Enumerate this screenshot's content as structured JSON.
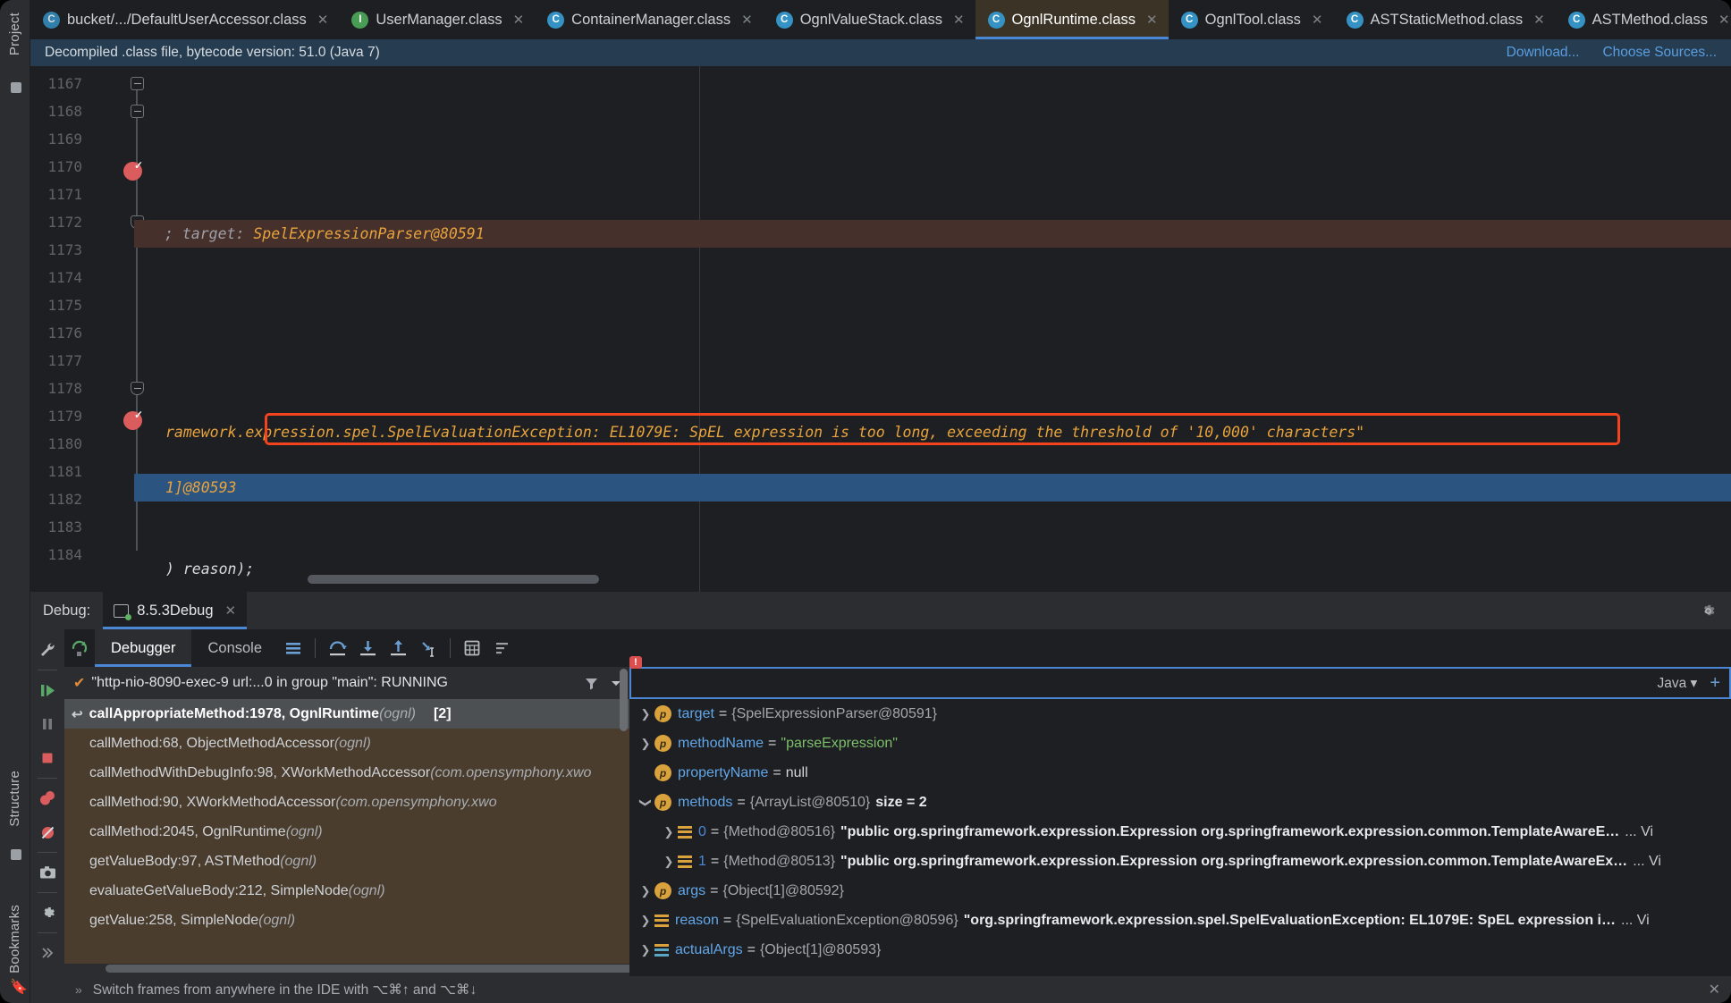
{
  "left_rail": {
    "project_label": "Project",
    "structure_label": "Structure",
    "bookmarks_label": "Bookmarks"
  },
  "editor_tabs": [
    {
      "label": "bucket/.../DefaultUserAccessor.class",
      "icon": "class-dim-icon",
      "icon_letter": "C",
      "active": false
    },
    {
      "label": "UserManager.class",
      "icon": "interface-icon",
      "icon_letter": "I",
      "active": false
    },
    {
      "label": "ContainerManager.class",
      "icon": "class-icon",
      "icon_letter": "C",
      "active": false
    },
    {
      "label": "OgnlValueStack.class",
      "icon": "class-icon",
      "icon_letter": "C",
      "active": false
    },
    {
      "label": "OgnlRuntime.class",
      "icon": "class-icon",
      "icon_letter": "C",
      "active": true
    },
    {
      "label": "OgnlTool.class",
      "icon": "class-icon",
      "icon_letter": "C",
      "active": false
    },
    {
      "label": "ASTStaticMethod.class",
      "icon": "class-icon",
      "icon_letter": "C",
      "active": false
    },
    {
      "label": "ASTMethod.class",
      "icon": "class-icon",
      "icon_letter": "C",
      "active": false
    }
  ],
  "notice": {
    "message": "Decompiled .class file, bytecode version: 51.0 (Java 7)",
    "download_label": "Download...",
    "choose_sources_label": "Choose Sources..."
  },
  "editor": {
    "line_numbers": [
      "1167",
      "1168",
      "1169",
      "1170",
      "1171",
      "1172",
      "1173",
      "1174",
      "1175",
      "1176",
      "1177",
      "1178",
      "1179",
      "1180",
      "1181",
      "1182",
      "1183",
      "1184"
    ],
    "code_lines": [
      {
        "line": "1170",
        "prefix": ";    target: ",
        "token": "SpelExpressionParser@80591",
        "highlight": "brown"
      },
      {
        "line": "1177",
        "pre": "ramework.",
        "boxed": "expression.spel.SpelEvaluationException: EL1079E: SpEL expression is too long, exceeding the threshold of '10,000' characters\"",
        "highlight": "none"
      },
      {
        "line": "1179",
        "text": "1]@80593",
        "highlight": "blue"
      },
      {
        "line": "1182",
        "text": ") reason);",
        "highlight": "none"
      }
    ]
  },
  "debug": {
    "panel_label": "Debug:",
    "session_tab": "8.5.3Debug",
    "tabs": [
      {
        "label": "Debugger",
        "active": true
      },
      {
        "label": "Console",
        "active": false
      }
    ],
    "toolbar_icons": [
      "layout-icon",
      "step-over-icon",
      "step-into-icon",
      "step-out-icon",
      "run-to-cursor-icon",
      "evaluate-icon",
      "sort-icon"
    ],
    "sidebar_icons": [
      "wrench-icon",
      "resume-icon",
      "pause-icon",
      "stop-icon",
      "breakpoints-icon",
      "mute-breakpoints-icon",
      "camera-icon",
      "settings-icon",
      "more-icon"
    ],
    "thread": {
      "status_icon": "check-icon",
      "label": "\"http-nio-8090-exec-9 url:...0 in group \"main\": RUNNING",
      "filter_icon": "filter-icon",
      "dropdown_icon": "chevron-down-icon"
    },
    "frames": [
      {
        "method": "callAppropriateMethod:1978, OgnlRuntime ",
        "pkg": "(ognl)",
        "badge": "[2]",
        "selected": true
      },
      {
        "method": "callMethod:68, ObjectMethodAccessor ",
        "pkg": "(ognl)",
        "badge": "",
        "selected": false
      },
      {
        "method": "callMethodWithDebugInfo:98, XWorkMethodAccessor ",
        "pkg": "(com.opensymphony.xwo",
        "badge": "",
        "selected": false
      },
      {
        "method": "callMethod:90, XWorkMethodAccessor ",
        "pkg": "(com.opensymphony.xwo",
        "badge": "",
        "selected": false
      },
      {
        "method": "callMethod:2045, OgnlRuntime ",
        "pkg": "(ognl)",
        "badge": "",
        "selected": false
      },
      {
        "method": "getValueBody:97, ASTMethod ",
        "pkg": "(ognl)",
        "badge": "",
        "selected": false
      },
      {
        "method": "evaluateGetValueBody:212, SimpleNode ",
        "pkg": "(ognl)",
        "badge": "",
        "selected": false
      },
      {
        "method": "getValue:258, SimpleNode ",
        "pkg": "(ognl)",
        "badge": "",
        "selected": false
      }
    ],
    "evaluate": {
      "value": "",
      "language_label": "Java",
      "add_icon": "plus-icon",
      "marker": "!"
    },
    "variables": [
      {
        "indent": 0,
        "expandable": true,
        "expanded": false,
        "icon": "param-icon",
        "name": "target",
        "eq": "=",
        "ref": "{SpelExpressionParser@80591}",
        "str": "",
        "null": "",
        "extra": ""
      },
      {
        "indent": 0,
        "expandable": true,
        "expanded": false,
        "icon": "param-icon",
        "name": "methodName",
        "eq": "=",
        "ref": "",
        "str": "\"parseExpression\"",
        "null": "",
        "extra": ""
      },
      {
        "indent": 0,
        "expandable": false,
        "expanded": false,
        "icon": "param-icon",
        "name": "propertyName",
        "eq": "=",
        "ref": "",
        "str": "",
        "null": "null",
        "extra": ""
      },
      {
        "indent": 0,
        "expandable": true,
        "expanded": true,
        "icon": "param-icon",
        "name": "methods",
        "eq": "=",
        "ref": "{ArrayList@80510}",
        "str": "",
        "null": "",
        "extra": "size = 2"
      },
      {
        "indent": 1,
        "expandable": true,
        "expanded": false,
        "icon": "list-icon",
        "name": "0",
        "eq": "=",
        "ref": "{Method@80516}",
        "str": "\"public org.springframework.expression.Expression org.springframework.expression.common.TemplateAwareE…",
        "null": "",
        "extra": "... Vi"
      },
      {
        "indent": 1,
        "expandable": true,
        "expanded": false,
        "icon": "list-icon",
        "name": "1",
        "eq": "=",
        "ref": "{Method@80513}",
        "str": "\"public org.springframework.expression.Expression org.springframework.expression.common.TemplateAwareEx…",
        "null": "",
        "extra": "... Vi"
      },
      {
        "indent": 0,
        "expandable": true,
        "expanded": false,
        "icon": "param-icon",
        "name": "args",
        "eq": "=",
        "ref": "{Object[1]@80592}",
        "str": "",
        "null": "",
        "extra": ""
      },
      {
        "indent": 0,
        "expandable": true,
        "expanded": false,
        "icon": "list-icon",
        "name": "reason",
        "eq": "=",
        "ref": "{SpelEvaluationException@80596}",
        "str": "\"org.springframework.expression.spel.SpelEvaluationException: EL1079E: SpEL expression i…",
        "null": "",
        "extra": "... Vi"
      },
      {
        "indent": 0,
        "expandable": true,
        "expanded": false,
        "icon": "array-icon",
        "name": "actualArgs",
        "eq": "=",
        "ref": "{Object[1]@80593}",
        "str": "",
        "null": "",
        "extra": ""
      }
    ],
    "status_hint": "Switch frames from anywhere in the IDE with ⌥⌘↑ and ⌥⌘↓"
  },
  "colors": {
    "accent_blue": "#4a88d6",
    "annotation_red": "#f4441e",
    "string_green": "#7dbf6b",
    "keyword_orange": "#e8a33d",
    "var_blue": "#61a6e8",
    "active_tab_bg": "#3b3326"
  }
}
